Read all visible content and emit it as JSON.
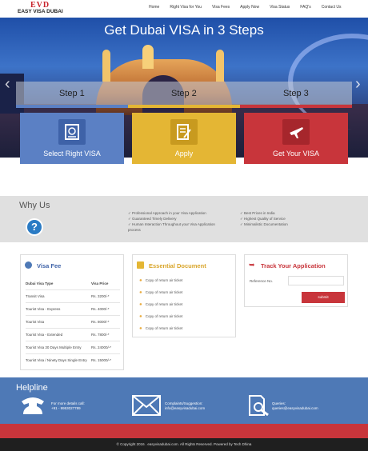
{
  "brand": {
    "mark": "EVD",
    "name": "EASY VISA DUBAI"
  },
  "nav": [
    "Home",
    "Right Visa for You",
    "Visa Fees",
    "Apply Now",
    "Visa Status",
    "FAQ's",
    "Contact Us"
  ],
  "hero": {
    "title": "Get Dubai VISA in 3 Steps"
  },
  "steps": [
    {
      "label": "Step 1",
      "card": "Select Right VISA"
    },
    {
      "label": "Step 2",
      "card": "Apply"
    },
    {
      "label": "Step 3",
      "card": "Get Your VISA"
    }
  ],
  "colors": {
    "blue": "#5b80c4",
    "yellow": "#e4b634",
    "red": "#c8353b",
    "helpline": "#4e79b6"
  },
  "why": {
    "title": "Why Us",
    "col1": [
      "✓ Professional Approach in your Visa Application",
      "✓ Guaranteed Timely Delivery",
      "✓ Human Interaction Throughout your Visa Application",
      "  process"
    ],
    "col2": [
      "✓ Best Prices in India",
      "✓ Highest Quality of Service",
      "✓ Minimalistic Documentation"
    ]
  },
  "visa_fee": {
    "title": "Visa Fee",
    "headers": [
      "Dubai Visa Type",
      "Visa Price"
    ],
    "rows": [
      [
        "Transit Visa",
        "Rs. 3200/-*"
      ],
      [
        "Tourist Visa - Express",
        "Rs. 4000/-*"
      ],
      [
        "Tourist Visa",
        "Rs. 8000/-*"
      ],
      [
        "Tourist Visa - Extended",
        "Rs. 7800/-*"
      ],
      [
        "Tourist Visa 30 Days Multiple Entry",
        "Rs. 24000/-*"
      ],
      [
        "Tourist Visa / Ninety Days Single Entry",
        "Rs. 15000/-*"
      ]
    ]
  },
  "documents": {
    "title": "Essential Document",
    "items": [
      "Copy of return air ticket",
      "Copy of return air ticket",
      "Copy of return air ticket",
      "Copy of return air ticket",
      "Copy of return air ticket"
    ]
  },
  "track": {
    "title": "Track Your Application",
    "ref_label": "Reference No.",
    "submit": "submit"
  },
  "helpline": {
    "title": "Helpline",
    "phone_label": "For more details call:",
    "phone": "+91 - 9953027789",
    "mail_label": "Complaints/Suggestion:",
    "mail": "info@easyvisadubai.com",
    "query_label": "Queries:",
    "query": "queries@easyvisadubai.com"
  },
  "footer": "© Copyright 2016 . easyvisadubai.com. All Rights Reserved. Powered by Tech Dhina"
}
